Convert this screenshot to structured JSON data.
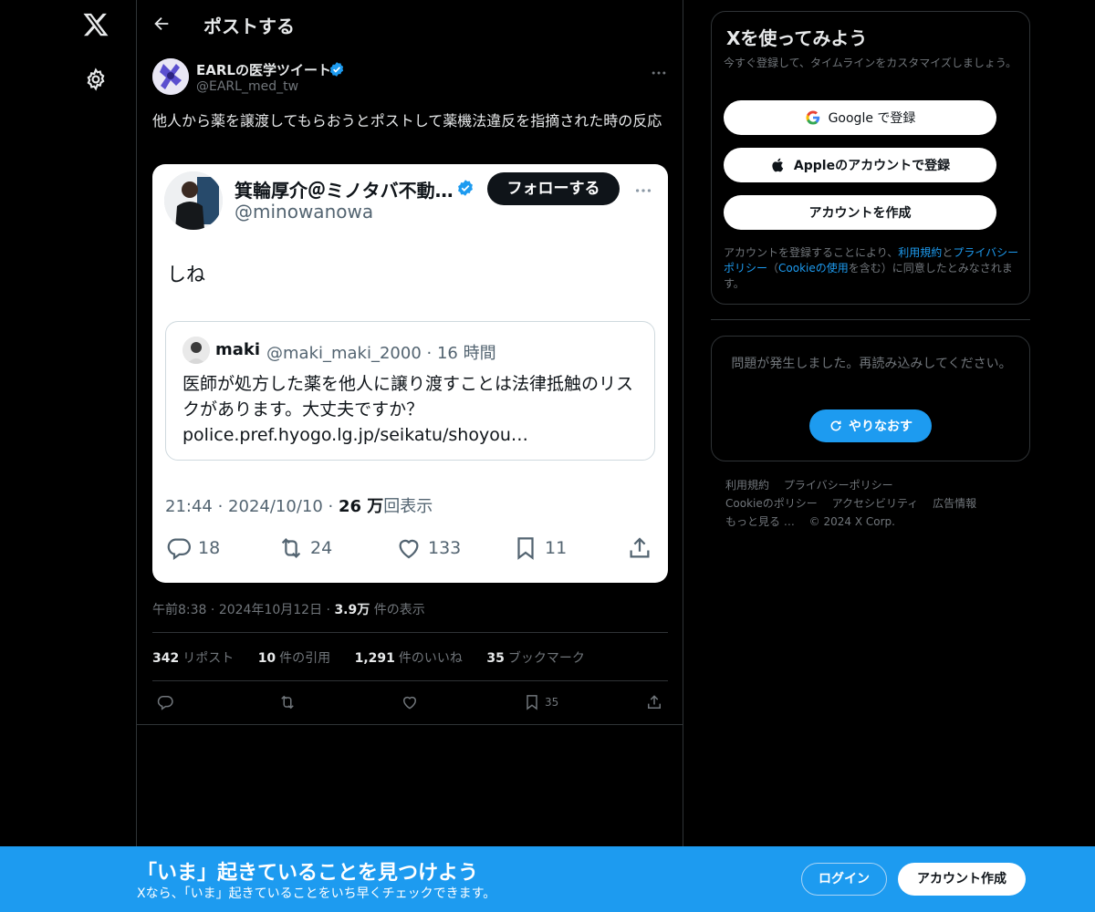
{
  "header": {
    "title": "ポストする"
  },
  "post": {
    "author_name": "EARLの医学ツイート",
    "author_handle": "@EARL_med_tw",
    "text": "他人から薬を譲渡してもらおうとポストして薬機法違反を指摘された時の反応",
    "time": "午前8:38",
    "date": "2024年10月12日",
    "views": "3.9万",
    "views_label": "件の表示",
    "stats": {
      "reposts": "342",
      "reposts_label": "リポスト",
      "quotes": "10",
      "quotes_label": "件の引用",
      "likes": "1,291",
      "likes_label": "件のいいね",
      "bookmarks": "35",
      "bookmarks_label": "ブックマーク"
    },
    "bookmark_count": "35"
  },
  "embedded": {
    "name": "箕輪厚介＠ミノタバ不動…",
    "handle": "@minowanowa",
    "follow_label": "フォローする",
    "body": "しね",
    "quote": {
      "name": "maki",
      "meta": "@maki_maki_2000 · 16 時間",
      "text": "医師が処方した薬を他人に譲り渡すことは法律抵触のリスクがあります。大丈夫ですか？ police.pref.hyogo.lg.jp/seikatu/shoyou…"
    },
    "timestamp": "21:44 · 2024/10/10 ·",
    "views": "26 万",
    "views_label": "回表示",
    "replies": "18",
    "retweets": "24",
    "likes": "133",
    "bookmarks": "11"
  },
  "signup": {
    "title": "Xを使ってみよう",
    "subtitle": "今すぐ登録して、タイムラインをカスタマイズしましょう。",
    "google_label": "Google で登録",
    "apple_label": "Appleのアカウントで登録",
    "create_label": "アカウントを作成",
    "terms_prefix": "アカウントを登録することにより、",
    "terms_link": "利用規約",
    "terms_and": "と",
    "privacy_link": "プライバシーポリシー",
    "terms_paren_open": "（",
    "cookie_link": "Cookieの使用",
    "terms_suffix": "を含む）に同意したとみなされます。"
  },
  "error": {
    "message": "問題が発生しました。再読み込みしてください。",
    "retry_label": "やりなおす"
  },
  "footer": {
    "links": [
      "利用規約",
      "プライバシーポリシー",
      "Cookieのポリシー",
      "アクセシビリティ",
      "広告情報",
      "もっと見る …",
      "© 2024 X Corp."
    ]
  },
  "banner": {
    "title": "「いま」起きていることを見つけよう",
    "subtitle": "Xなら、「いま」起きていることをいち早くチェックできます。",
    "login_label": "ログイン",
    "signup_label": "アカウント作成"
  },
  "colors": {
    "accent": "#1d9bf0",
    "background": "#000000",
    "border": "#2f3336",
    "muted": "#71767b"
  }
}
